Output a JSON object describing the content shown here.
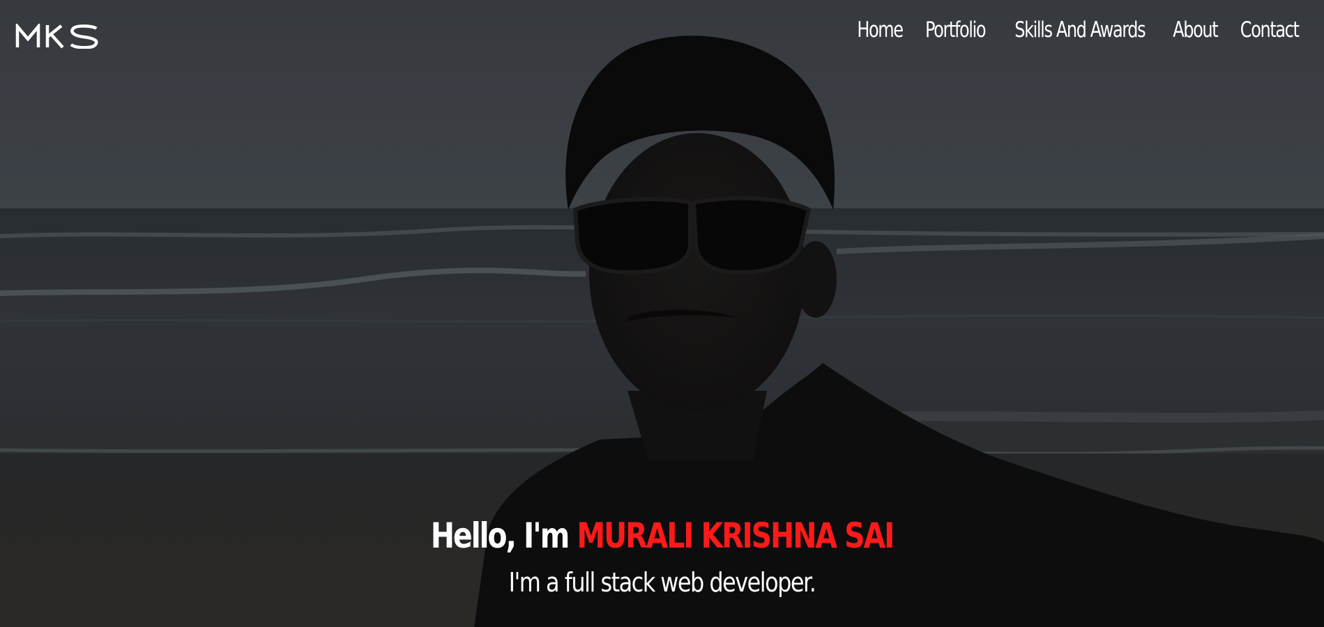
{
  "brand": {
    "logo_text": "MKS"
  },
  "nav": {
    "items": [
      {
        "label": "Home"
      },
      {
        "label": "Portfolio"
      },
      {
        "label": "Skills And Awards"
      },
      {
        "label": "About"
      },
      {
        "label": "Contact"
      }
    ]
  },
  "hero": {
    "greeting_prefix": "Hello, I'm",
    "name": "MURALI KRISHNA SAI",
    "tagline": "I'm a full stack web developer."
  },
  "colors": {
    "accent": "#ff1a1a",
    "text": "#ffffff"
  }
}
